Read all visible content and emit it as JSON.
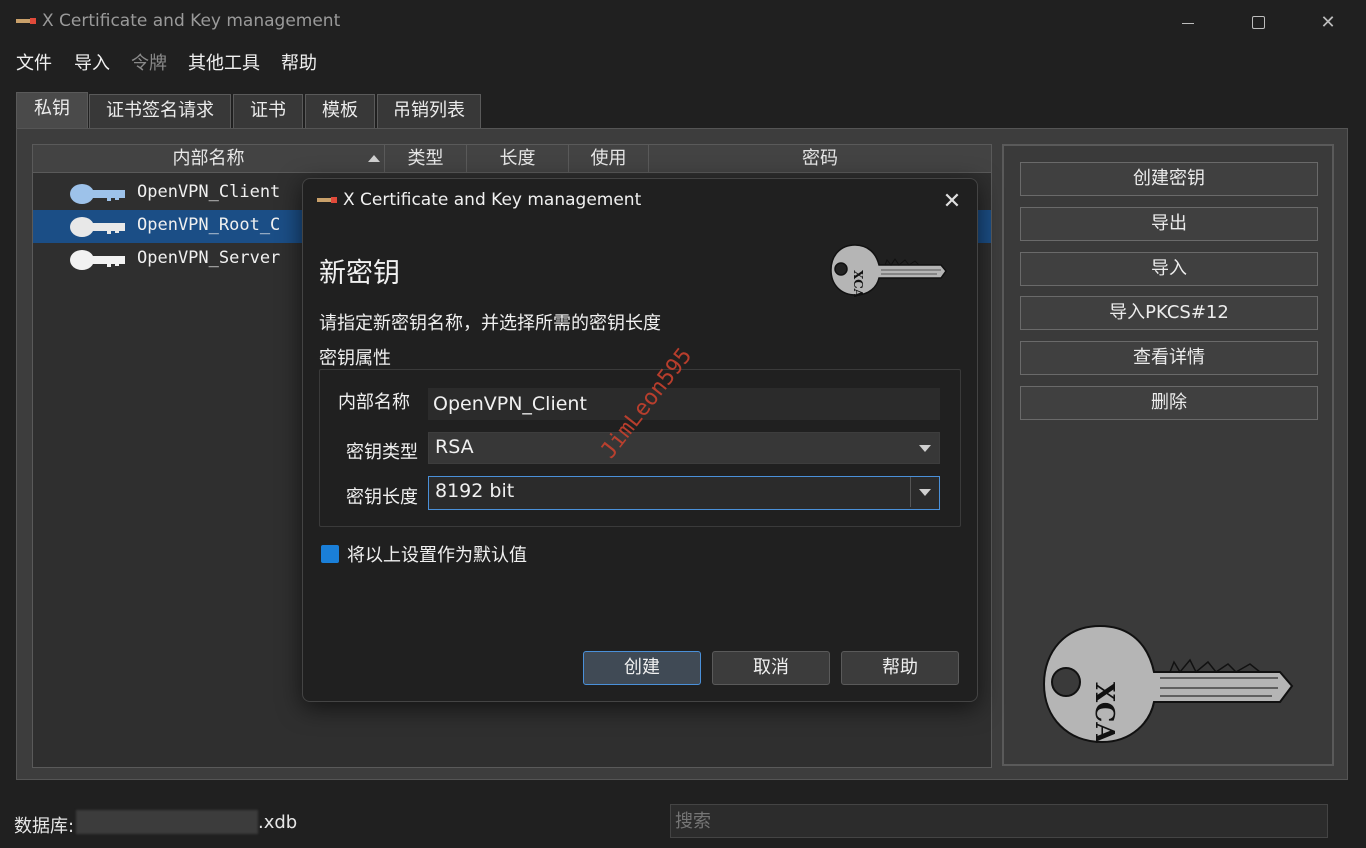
{
  "window": {
    "title": "X Certificate and Key management"
  },
  "menu": [
    "文件",
    "导入",
    "令牌",
    "其他工具",
    "帮助"
  ],
  "tabs": [
    "私钥",
    "证书签名请求",
    "证书",
    "模板",
    "吊销列表"
  ],
  "table": {
    "columns": [
      "内部名称",
      "类型",
      "长度",
      "使用",
      "密码"
    ],
    "rows": [
      {
        "name": "OpenVPN_Client",
        "selected": false
      },
      {
        "name": "OpenVPN_Root_C",
        "selected": true
      },
      {
        "name": "OpenVPN_Server",
        "selected": false
      }
    ]
  },
  "side_buttons": [
    "创建密钥",
    "导出",
    "导入",
    "导入PKCS#12",
    "查看详情",
    "删除"
  ],
  "status": {
    "db_label": "数据库:",
    "db_ext": ".xdb",
    "search_placeholder": "搜索"
  },
  "dialog": {
    "title": "X Certificate and Key management",
    "heading": "新密钥",
    "description": "请指定新密钥名称，并选择所需的密钥长度",
    "group_label": "密钥属性",
    "name_label": "内部名称",
    "name_value": "OpenVPN_Client",
    "type_label": "密钥类型",
    "type_value": "RSA",
    "length_label": "密钥长度",
    "length_value": "8192 bit",
    "default_checkbox_label": "将以上设置作为默认值",
    "buttons": [
      "创建",
      "取消",
      "帮助"
    ]
  },
  "watermark": "JimLeon595",
  "colors": {
    "accent": "#1a7fd8",
    "selection": "#1b4e86",
    "focus": "#4a90d9"
  }
}
